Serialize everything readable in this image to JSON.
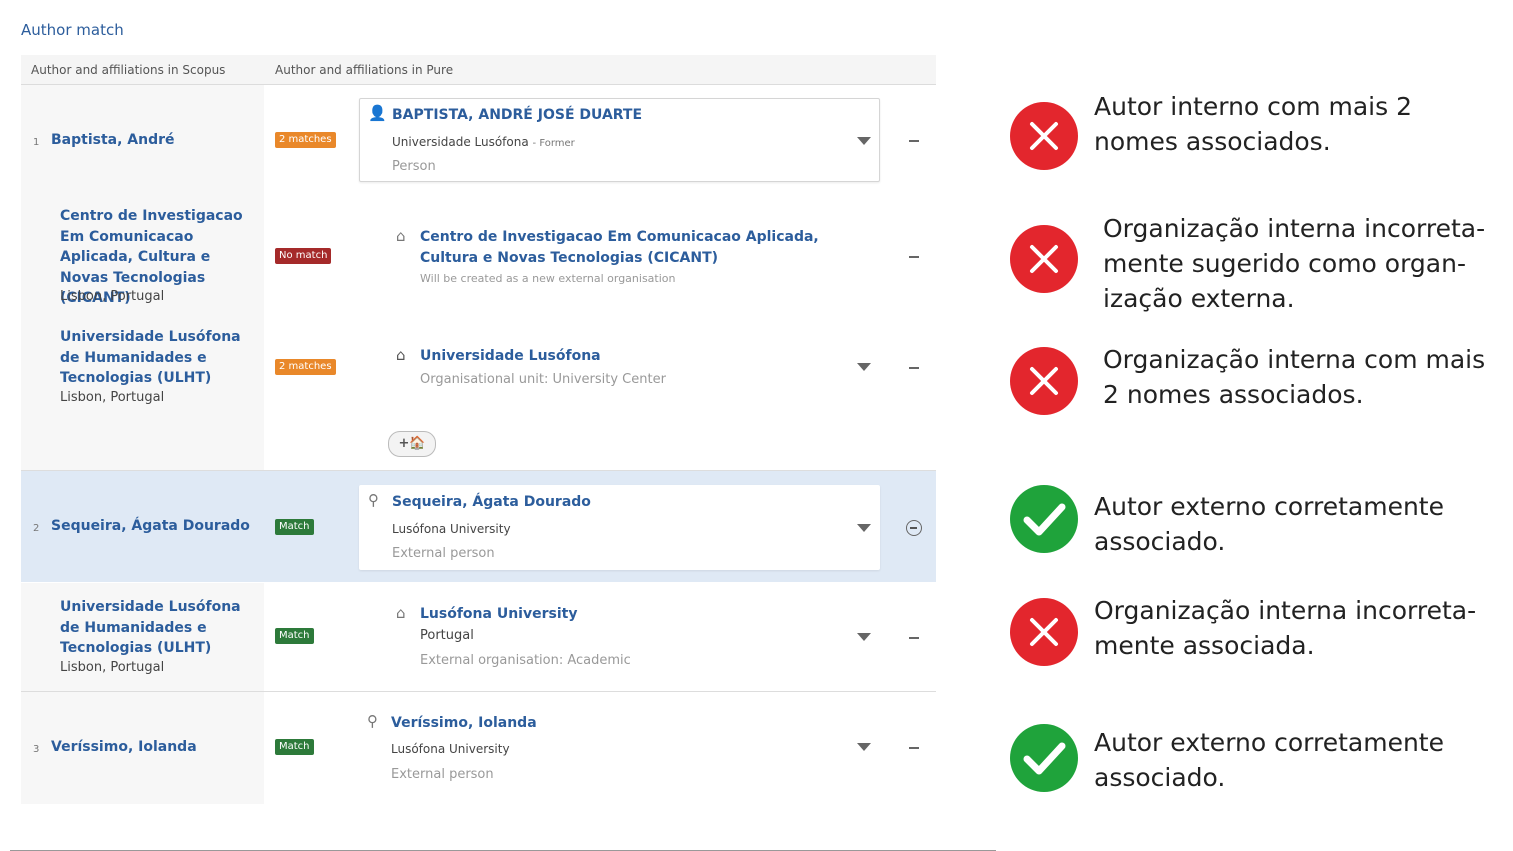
{
  "page_title": "Author match",
  "headers": {
    "scopus": "Author and affiliations in Scopus",
    "pure": "Author and affiliations in Pure"
  },
  "authors": [
    {
      "num": "1",
      "name": "Baptista, André",
      "badge": "2 matches",
      "pure": {
        "name": "BAPTISTA, ANDRÉ JOSÉ DUARTE",
        "org": "Universidade Lusófona",
        "org_note": "- Former",
        "type": "Person"
      }
    },
    {
      "num": "2",
      "name": "Sequeira, Ágata Dourado",
      "badge": "Match",
      "pure": {
        "name": "Sequeira, Ágata Dourado",
        "org": "Lusófona University",
        "type": "External person"
      }
    },
    {
      "num": "3",
      "name": "Veríssimo, Iolanda",
      "badge": "Match",
      "pure": {
        "name": "Veríssimo, Iolanda",
        "org": "Lusófona University",
        "type": "External person"
      }
    }
  ],
  "affiliations": [
    {
      "scopus_name": "Centro de Investigacao Em Comunicacao Aplicada, Cultura e Novas Tecnologias (CICANT)",
      "location": "Lisbon, Portugal",
      "badge": "No match",
      "pure_name": "Centro de Investigacao Em Comunicacao Aplicada, Cultura e Novas Tecnologias (CICANT)",
      "pure_note": "Will be created as a new external organisation"
    },
    {
      "scopus_name": "Universidade Lusófona de Humanidades e Tecnologias (ULHT)",
      "location": "Lisbon, Portugal",
      "badge": "2 matches",
      "pure_name": "Universidade Lusófona",
      "pure_note": "Organisational unit: University Center"
    },
    {
      "scopus_name": "Universidade Lusófona de Humanidades e Tecnologias (ULHT)",
      "location": "Lisbon, Portugal",
      "badge": "Match",
      "pure_name": "Lusófona University",
      "pure_sub": "Portugal",
      "pure_note": "External organisation: Academic"
    }
  ],
  "add_org_button": "+🏠",
  "annotations": [
    {
      "status": "error",
      "icon": "x-circle-icon",
      "text": "Autor interno com mais 2 nomes associados."
    },
    {
      "status": "error",
      "icon": "x-circle-icon",
      "text": "Organização interna incorreta-mente sugerido como organ-ização externa."
    },
    {
      "status": "error",
      "icon": "x-circle-icon",
      "text": "Organização interna com mais 2 nomes associados."
    },
    {
      "status": "ok",
      "icon": "check-circle-icon",
      "text": "Autor externo corretamente associado."
    },
    {
      "status": "error",
      "icon": "x-circle-icon",
      "text": "Organização interna incorreta-mente associada."
    },
    {
      "status": "ok",
      "icon": "check-circle-icon",
      "text": "Autor externo corretamente associado."
    }
  ],
  "colors": {
    "error": "#e3262d",
    "ok": "#1fa33b",
    "link": "#2c5d9c",
    "selected_row": "#dfe9f5"
  }
}
